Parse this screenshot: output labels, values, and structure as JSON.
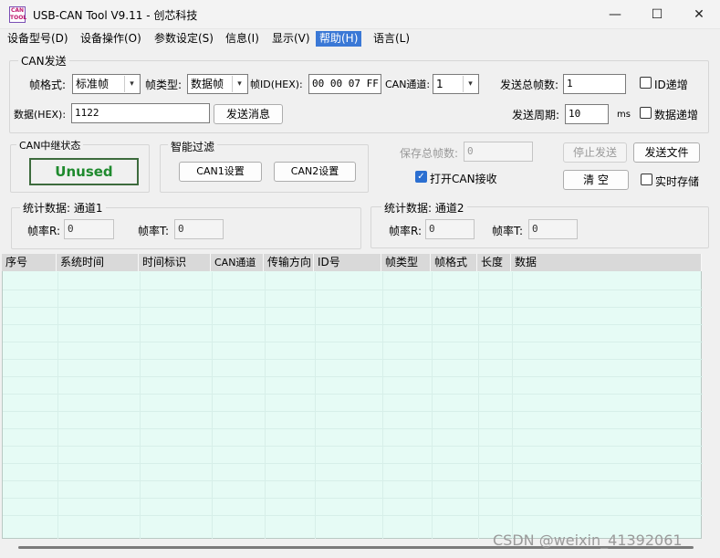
{
  "window": {
    "title": "USB-CAN Tool V9.11 - 创芯科技",
    "icon_text": "CAN TOOL",
    "minimize_glyph": "—",
    "maximize_glyph": "☐",
    "close_glyph": "✕"
  },
  "menu": {
    "items": [
      "设备型号(D)",
      "设备操作(O)",
      "参数设定(S)",
      "信息(I)",
      "显示(V)",
      "帮助(H)",
      "语言(L)"
    ],
    "active": "帮助(H)"
  },
  "can_send": {
    "group_title": "CAN发送",
    "frame_format_label": "帧格式:",
    "frame_format_value": "标准帧",
    "frame_type_label": "帧类型:",
    "frame_type_value": "数据帧",
    "frame_id_label": "帧ID(HEX):",
    "frame_id_value": "00 00 07 FF",
    "channel_label": "CAN通道:",
    "channel_value": "1",
    "total_frames_label": "发送总帧数:",
    "total_frames_value": "1",
    "id_increment_label": "ID递增",
    "data_label": "数据(HEX):",
    "data_value": "1122",
    "send_button": "发送消息",
    "period_label": "发送周期:",
    "period_value": "10",
    "period_unit": "ms",
    "data_increment_label": "数据递增"
  },
  "relay": {
    "group_title": "CAN中继状态",
    "status": "Unused",
    "status_color": "#1f8a2e"
  },
  "filter": {
    "group_title": "智能过滤",
    "can1_button": "CAN1设置",
    "can2_button": "CAN2设置"
  },
  "controls": {
    "saved_frames_label": "保存总帧数:",
    "saved_frames_value": "0",
    "open_can_receive_label": "打开CAN接收",
    "open_can_receive_checked": true,
    "stop_send_button": "停止发送",
    "send_file_button": "发送文件",
    "clear_button": "清 空",
    "realtime_save_label": "实时存储"
  },
  "stats": {
    "ch1": {
      "title": "统计数据: 通道1",
      "rx_label": "帧率R:",
      "rx_value": "0",
      "tx_label": "帧率T:",
      "tx_value": "0"
    },
    "ch2": {
      "title": "统计数据: 通道2",
      "rx_label": "帧率R:",
      "rx_value": "0",
      "tx_label": "帧率T:",
      "tx_value": "0"
    }
  },
  "table": {
    "columns": [
      "序号",
      "系统时间",
      "时间标识",
      "CAN通道",
      "传输方向",
      "ID号",
      "帧类型",
      "帧格式",
      "长度",
      "数据"
    ],
    "rows": []
  },
  "watermark": "CSDN @weixin_41392061"
}
